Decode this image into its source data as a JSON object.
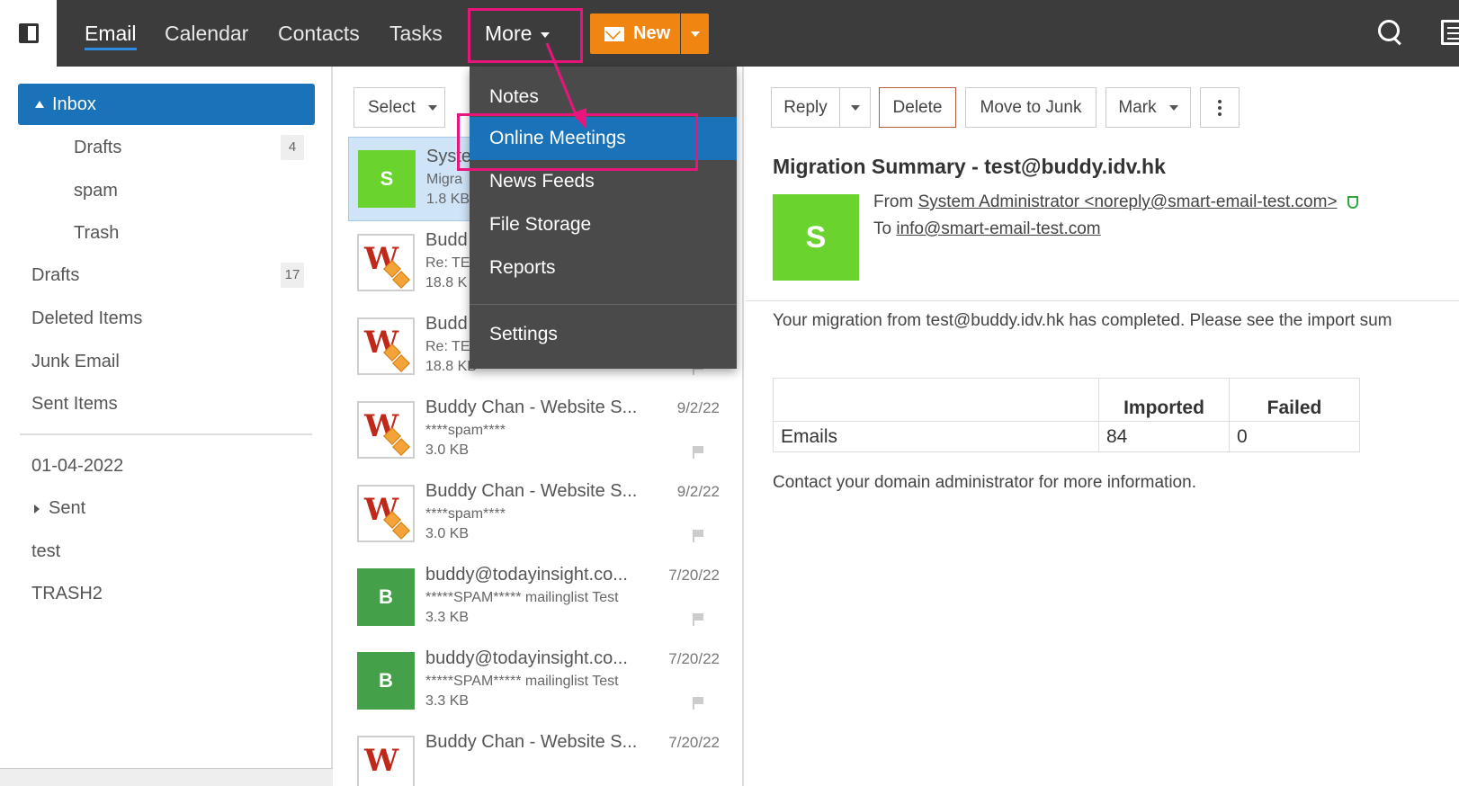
{
  "nav": {
    "items": [
      "Email",
      "Calendar",
      "Contacts",
      "Tasks",
      "More"
    ],
    "new_label": "New"
  },
  "folders": {
    "items": [
      {
        "label": "Inbox",
        "badge": ""
      },
      {
        "label": "Drafts",
        "badge": "4"
      },
      {
        "label": "spam",
        "badge": ""
      },
      {
        "label": "Trash",
        "badge": ""
      },
      {
        "label": "Drafts",
        "badge": "17"
      },
      {
        "label": "Deleted Items",
        "badge": ""
      },
      {
        "label": "Junk Email",
        "badge": ""
      },
      {
        "label": "Sent Items",
        "badge": ""
      },
      {
        "label": "01-04-2022",
        "badge": ""
      },
      {
        "label": "Sent",
        "badge": ""
      },
      {
        "label": "test",
        "badge": ""
      },
      {
        "label": "TRASH2",
        "badge": ""
      }
    ]
  },
  "list": {
    "select_label": "Select",
    "messages": [
      {
        "from": "Syste",
        "subject": "Migra",
        "size": "1.8 KB",
        "date": "",
        "avatar": "S"
      },
      {
        "from": "Budd",
        "subject": "Re: TE",
        "size": "18.8 K",
        "date": "",
        "avatar": ""
      },
      {
        "from": "Budd",
        "subject": "Re: TE",
        "size": "18.8 KB",
        "date": "",
        "avatar": ""
      },
      {
        "from": "Buddy Chan - Website S...",
        "subject": "****spam****",
        "size": "3.0 KB",
        "date": "9/2/22",
        "avatar": ""
      },
      {
        "from": "Buddy Chan - Website S...",
        "subject": "****spam****",
        "size": "3.0 KB",
        "date": "9/2/22",
        "avatar": ""
      },
      {
        "from": "buddy@todayinsight.co...",
        "subject": "*****SPAM***** mailinglist Test",
        "size": "3.3 KB",
        "date": "7/20/22",
        "avatar": "B"
      },
      {
        "from": "buddy@todayinsight.co...",
        "subject": "*****SPAM***** mailinglist Test",
        "size": "3.3 KB",
        "date": "7/20/22",
        "avatar": "B"
      },
      {
        "from": "Buddy Chan - Website S...",
        "subject": "",
        "size": "",
        "date": "7/20/22",
        "avatar": ""
      }
    ]
  },
  "dropdown": {
    "items": [
      "Notes",
      "Online Meetings",
      "News Feeds",
      "File Storage",
      "Reports",
      "Settings"
    ],
    "highlighted": "Online Meetings"
  },
  "reader": {
    "toolbar": {
      "reply": "Reply",
      "delete": "Delete",
      "move_to_junk": "Move to Junk",
      "mark": "Mark"
    },
    "subject": "Migration Summary - test@buddy.idv.hk",
    "avatar": "S",
    "from_label": "From",
    "from_value": "System Administrator <noreply@smart-email-test.com>",
    "to_label": "To",
    "to_value": "info@smart-email-test.com",
    "body_intro": "Your migration from test@buddy.idv.hk has completed. Please see the import sum",
    "table": {
      "headers": [
        "",
        "Imported",
        "Failed"
      ],
      "row": [
        "Emails",
        "84",
        "0"
      ]
    },
    "body_footer": "Contact your domain administrator for more information."
  },
  "colors": {
    "accent": "#1a73b8",
    "new_button": "#f08512",
    "highlight": "#e8157c",
    "avatar_green": "#6ad32d"
  }
}
